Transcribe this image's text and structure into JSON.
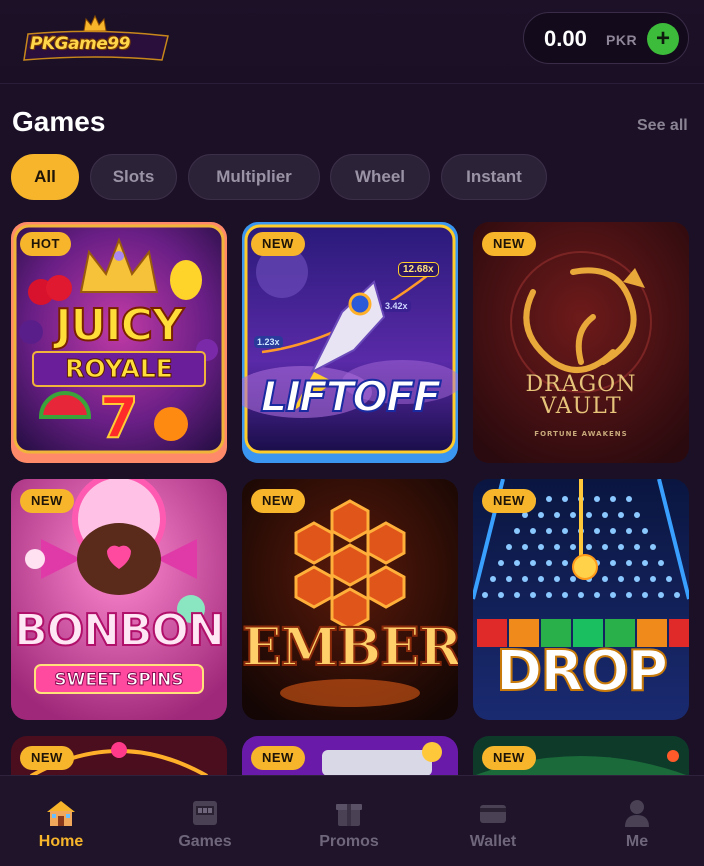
{
  "header": {
    "logo_text": "PKGame99",
    "balance": "0.00",
    "currency": "PKR",
    "add_label": "+"
  },
  "section": {
    "title": "Games",
    "see_all": "See all"
  },
  "filters": [
    "All",
    "Slots",
    "Multiplier",
    "Wheel",
    "Instant"
  ],
  "active_filter": "All",
  "games": [
    {
      "badge": "HOT",
      "title": "JUICY",
      "subtitle": "ROYALE",
      "extra": "7"
    },
    {
      "badge": "NEW",
      "title": "LIFTOFF",
      "multiplier_top": "12.68x",
      "multiplier_mid": "3.42x",
      "multiplier_low": "1.23x"
    },
    {
      "badge": "NEW",
      "title": "DRAGON",
      "subtitle": "VAULT",
      "tagline": "FORTUNE AWAKENS"
    },
    {
      "badge": "NEW",
      "title": "BONBON",
      "subtitle": "SWEET SPINS"
    },
    {
      "badge": "NEW",
      "title": "EMBER"
    },
    {
      "badge": "NEW",
      "title": "DROP"
    },
    {
      "badge": "NEW"
    },
    {
      "badge": "NEW"
    },
    {
      "badge": "NEW"
    }
  ],
  "nav": [
    {
      "label": "Home",
      "icon": "home-icon"
    },
    {
      "label": "Games",
      "icon": "slot-machine-icon"
    },
    {
      "label": "Promos",
      "icon": "gift-icon"
    },
    {
      "label": "Wallet",
      "icon": "wallet-icon"
    },
    {
      "label": "Me",
      "icon": "person-icon"
    }
  ],
  "colors": {
    "accent": "#f7b52c",
    "background": "#1b1026",
    "add": "#3dbb3a"
  }
}
